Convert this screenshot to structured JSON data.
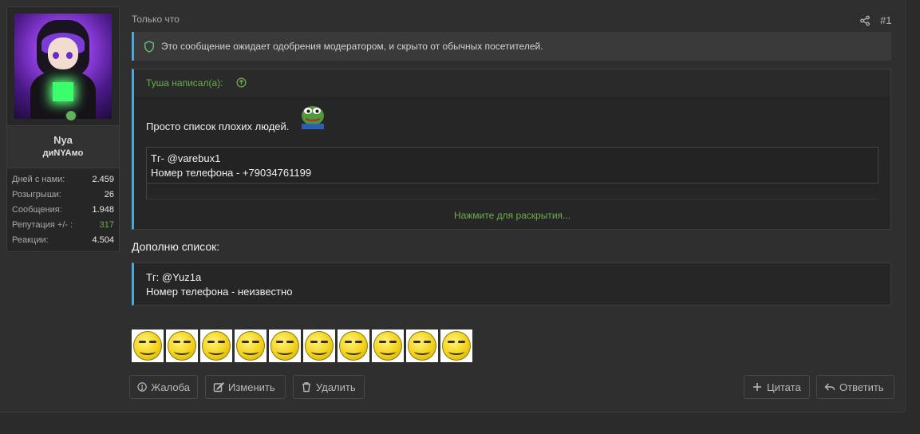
{
  "user": {
    "name": "Nya",
    "title": "диNYAмо",
    "stats": [
      {
        "label": "Дней с нами:",
        "value": "2.459"
      },
      {
        "label": "Розыгрыши:",
        "value": "26"
      },
      {
        "label": "Сообщения:",
        "value": "1.948"
      },
      {
        "label": "Репутация +/- :",
        "value": "317",
        "color": "#6cae4f"
      },
      {
        "label": "Реакции:",
        "value": "4.504"
      }
    ]
  },
  "post": {
    "time": "Только что",
    "number": "#1",
    "share_icon": "share-icon"
  },
  "notice": {
    "icon": "shield-check-icon",
    "text": "Это сообщение ожидает одобрения модератором, и скрыто от обычных посетителей."
  },
  "quote1": {
    "author": "Туша написал(а):",
    "text": "Просто список плохих людей.",
    "emoji": "pepe-emoji",
    "inner_lines": [
      "Тг- @varebux1",
      "Номер телефона - +79034761199"
    ],
    "expand_label": "Нажмите для раскрытия..."
  },
  "body_text": "Дополню список:",
  "quote2": {
    "lines": [
      "Тг: @Yuz1a",
      "Номер телефона - неизвестно"
    ]
  },
  "smileys": {
    "count": 10,
    "icon": "smirk-smiley"
  },
  "actions": {
    "report": "Жалоба",
    "edit": "Изменить",
    "delete": "Удалить",
    "quote": "Цитата",
    "reply": "Ответить"
  },
  "colors": {
    "accent_green": "#6cae4f",
    "quote_border": "#4aa8d8",
    "background": "#2f2f2f"
  }
}
